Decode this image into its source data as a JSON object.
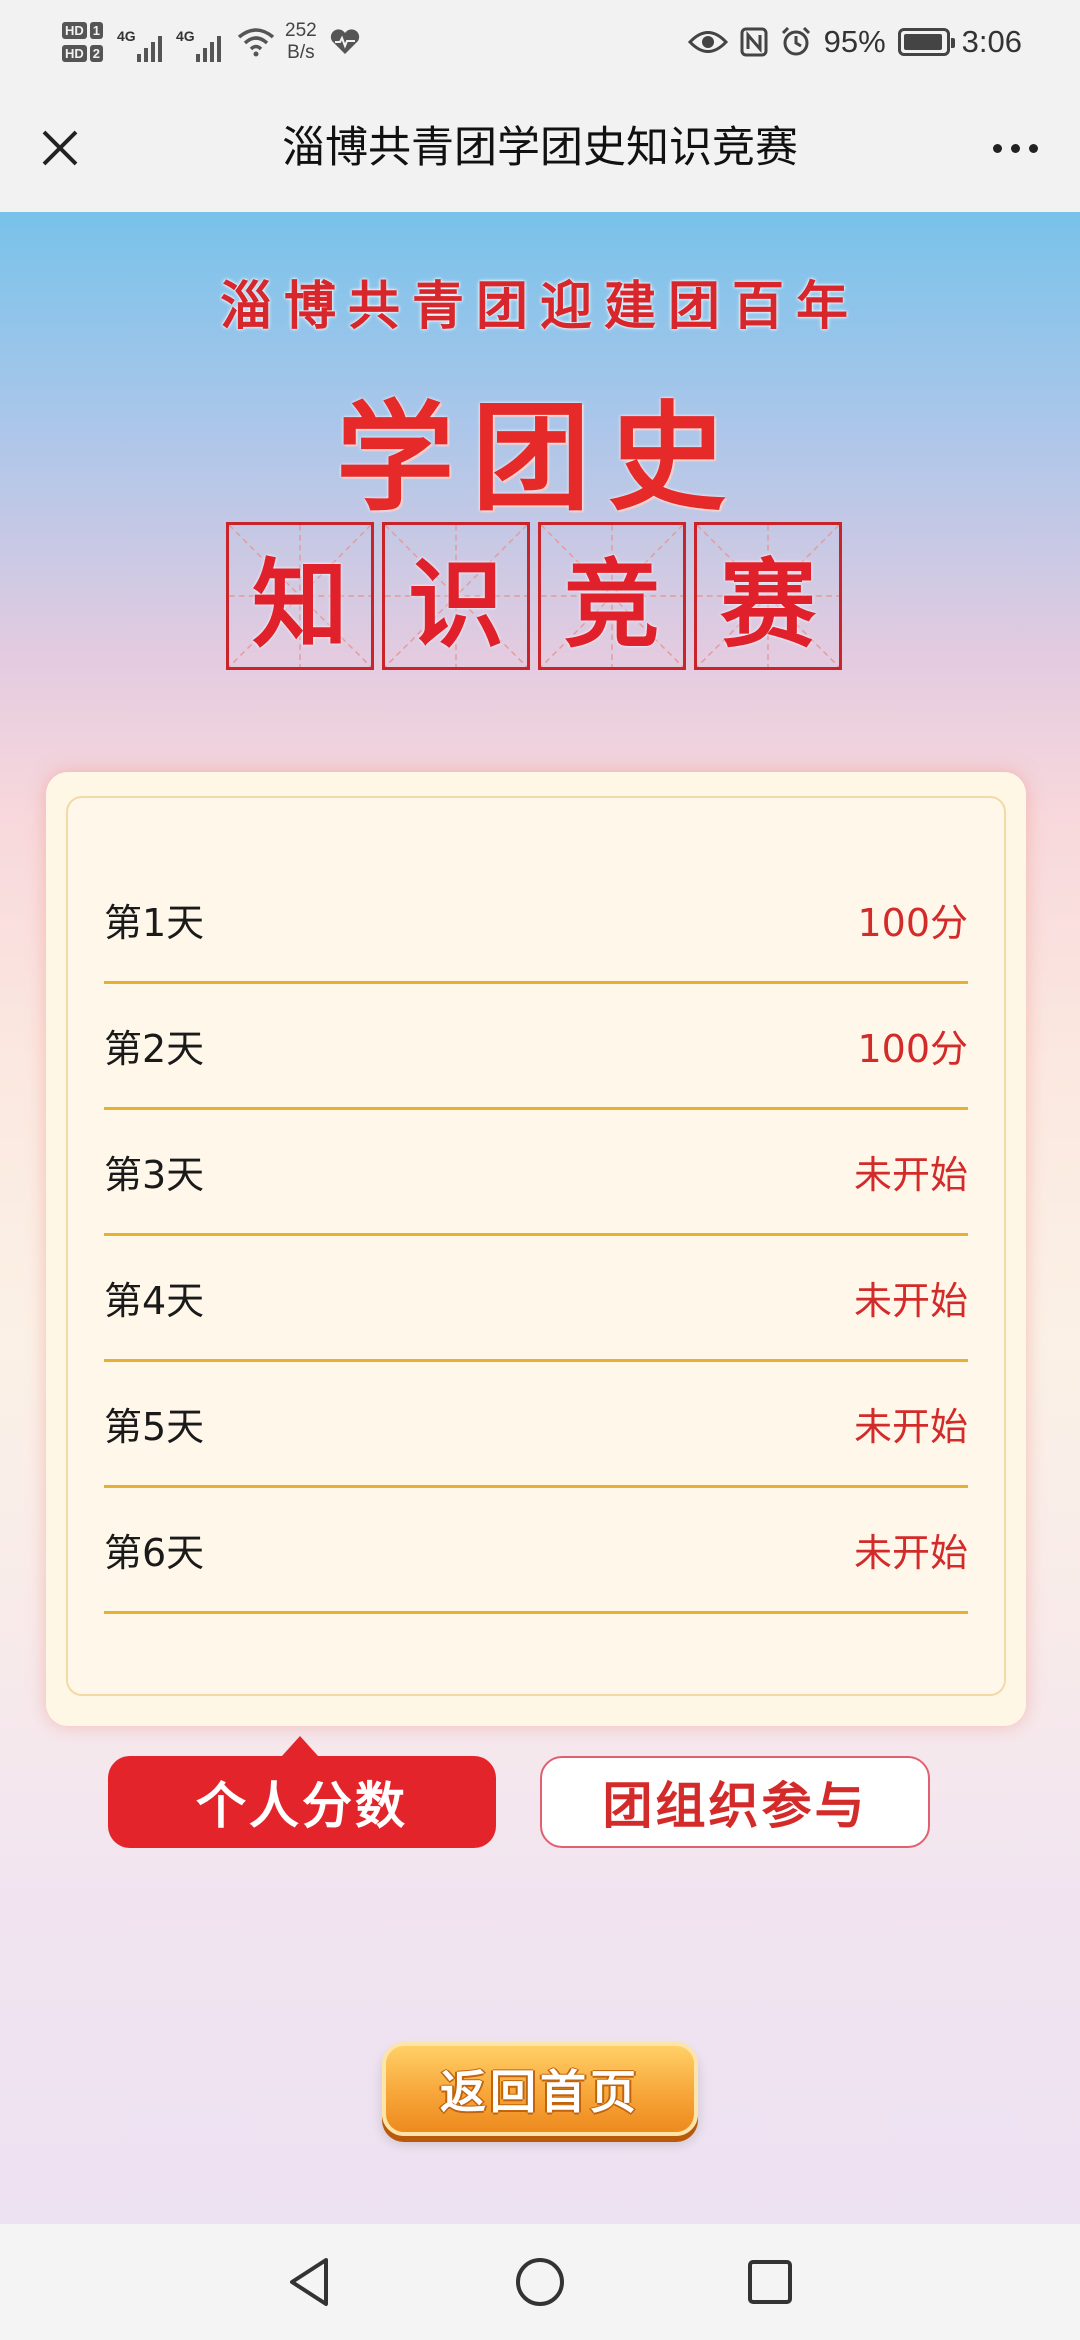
{
  "status_bar": {
    "sim1_label": "HD",
    "sim1_num": "1",
    "sim2_label": "HD",
    "sim2_num": "2",
    "network1": "4G",
    "network2": "4G",
    "speed_value": "252",
    "speed_unit": "B/s",
    "battery": "95%",
    "battery_level": 0.95,
    "time": "3:06"
  },
  "title_bar": {
    "title": "淄博共青团学团史知识竞赛"
  },
  "banner": {
    "subtitle": "淄博共青团迎建团百年",
    "headline": "学团史",
    "boxed_chars": [
      "知",
      "识",
      "竞",
      "赛"
    ]
  },
  "score_list": [
    {
      "day": "第1天",
      "status": "100分"
    },
    {
      "day": "第2天",
      "status": "100分"
    },
    {
      "day": "第3天",
      "status": "未开始"
    },
    {
      "day": "第4天",
      "status": "未开始"
    },
    {
      "day": "第5天",
      "status": "未开始"
    },
    {
      "day": "第6天",
      "status": "未开始"
    }
  ],
  "tabs": {
    "personal": "个人分数",
    "org": "团组织参与"
  },
  "home_button": "返回首页",
  "colors": {
    "accent_red": "#e3242b",
    "line_gold": "#e8b030",
    "card_bg": "#fff7e6",
    "home_orange": "#f7a63a"
  }
}
